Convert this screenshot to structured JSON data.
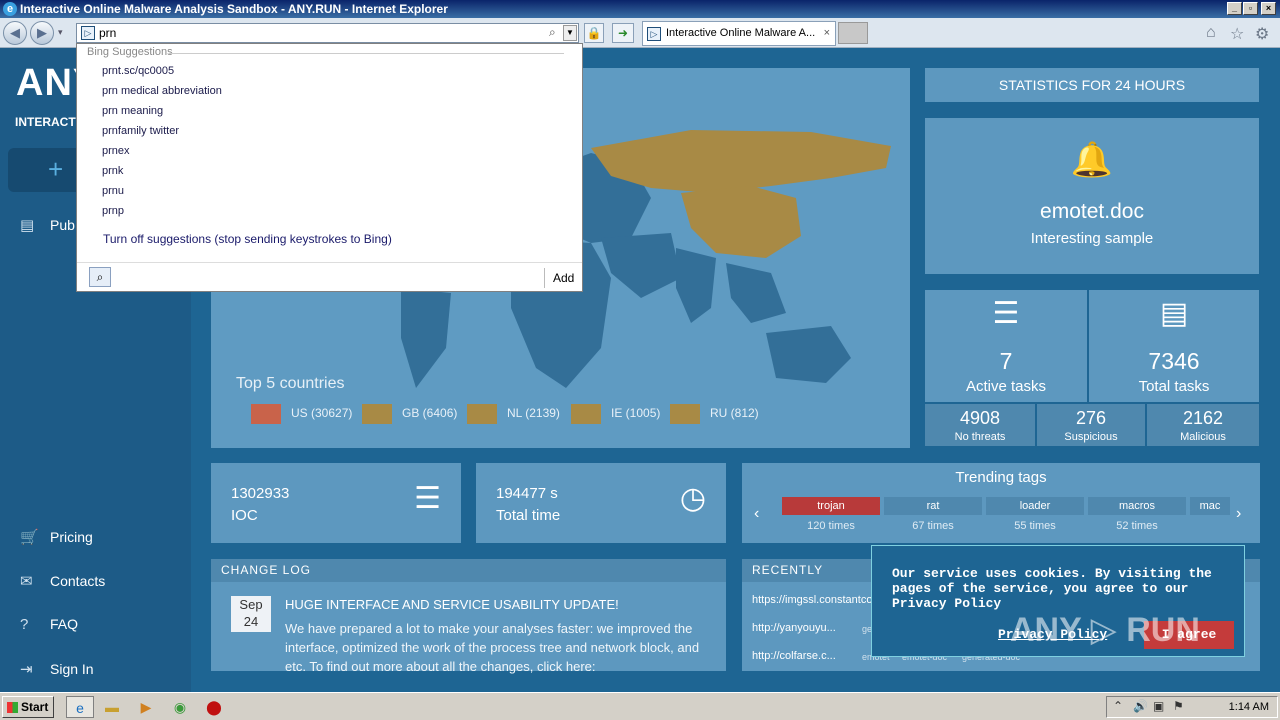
{
  "window": {
    "title": "Interactive Online Malware Analysis Sandbox - ANY.RUN - Internet Explorer",
    "controls": [
      "_",
      "▫",
      "×"
    ]
  },
  "browser": {
    "address_value": "prn",
    "tab_label": "Interactive Online Malware A...",
    "tab_close": "×"
  },
  "suggestions": {
    "header": "Bing Suggestions",
    "items": [
      "prnt.sc/qc0005",
      "prn medical abbreviation",
      "prn meaning",
      "prnfamily twitter",
      "prnex",
      "prnk",
      "prnu",
      "prnp"
    ],
    "turn_off": "Turn off suggestions (stop sending keystrokes to Bing)",
    "add": "Add"
  },
  "sidebar": {
    "logo": "ANY",
    "tagline": "INTERACTIVE",
    "new_task": "+",
    "public": "Pub",
    "nav": [
      {
        "label": "Pricing",
        "icon": "🛒"
      },
      {
        "label": "Contacts",
        "icon": "✉"
      },
      {
        "label": "FAQ",
        "icon": "?"
      },
      {
        "label": "Sign In",
        "icon": "⇥"
      }
    ]
  },
  "map": {
    "top_label": "Top 5 countries",
    "countries": [
      {
        "label": "US (30627)",
        "color": "#c9634a"
      },
      {
        "label": "GB (6406)",
        "color": "#a88a45"
      },
      {
        "label": "NL (2139)",
        "color": "#a88a45"
      },
      {
        "label": "IE (1005)",
        "color": "#a88a45"
      },
      {
        "label": "RU (812)",
        "color": "#a88a45"
      }
    ]
  },
  "stats": {
    "header": "STATISTICS FOR 24 HOURS",
    "sample_name": "emotet.doc",
    "sample_sub": "Interesting sample",
    "active_num": "7",
    "active_label": "Active tasks",
    "total_num": "7346",
    "total_label": "Total tasks",
    "no_threats_num": "4908",
    "no_threats_label": "No threats",
    "suspicious_num": "276",
    "suspicious_label": "Suspicious",
    "malicious_num": "2162",
    "malicious_label": "Malicious"
  },
  "ioc": {
    "num": "1302933",
    "label": "IOC"
  },
  "total_time": {
    "num": "194477 s",
    "label": "Total time"
  },
  "trending": {
    "header": "Trending tags",
    "tags": [
      {
        "name": "trojan",
        "count": "120 times"
      },
      {
        "name": "rat",
        "count": "67 times"
      },
      {
        "name": "loader",
        "count": "55 times"
      },
      {
        "name": "macros",
        "count": "52 times"
      },
      {
        "name": "mac",
        "count": ""
      }
    ]
  },
  "changelog": {
    "header": "CHANGE LOG",
    "month": "Sep",
    "day": "24",
    "title": "HUGE INTERFACE AND SERVICE USABILITY UPDATE!",
    "text": "We have prepared a lot to make your analyses faster: we improved the interface, optimized the work of the process tree and network block, and etc. To find out more about all the changes, click here:"
  },
  "recent": {
    "header": "RECENTLY",
    "rows": [
      {
        "url": "https://imgssl.constantcontact.com/letters/images/sys/S.gif",
        "tags": [
          "",
          "",
          ""
        ]
      },
      {
        "url": "http://yanyouyu...",
        "tags": [
          "generated-doc",
          "emotet",
          "emotet-doc"
        ]
      },
      {
        "url": "http://colfarse.c...",
        "tags": [
          "emotet",
          "emotet-doc",
          "generated-doc"
        ]
      }
    ]
  },
  "cookie": {
    "message": "Our service uses cookies. By visiting the pages of the service, you agree to our Privacy Policy",
    "policy_link": "Privacy Policy",
    "agree": "I agree"
  },
  "watermark": "ANY ▷ RUN",
  "taskbar": {
    "start": "Start",
    "clock": "1:14 AM"
  }
}
